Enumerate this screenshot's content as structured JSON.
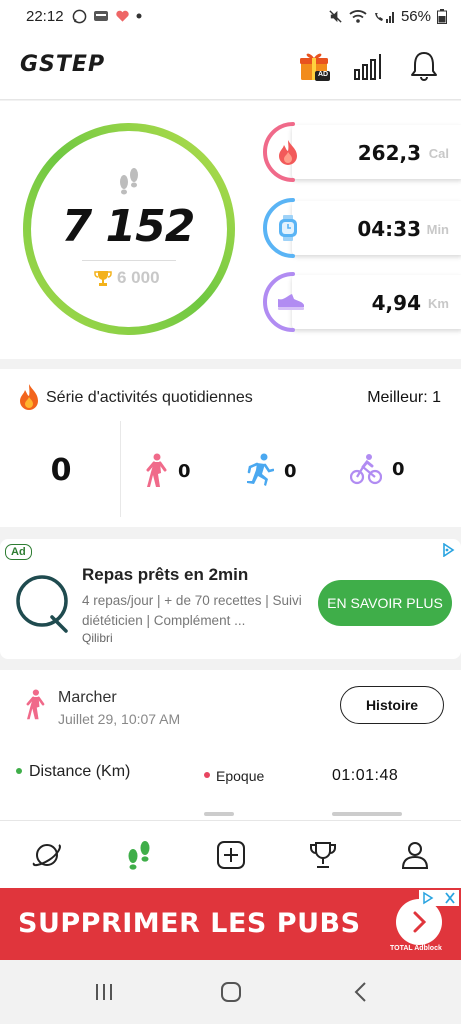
{
  "status_bar": {
    "time": "22:12",
    "battery": "56%",
    "icons": [
      "whatsapp-icon",
      "cashback-icon",
      "heart-icon",
      "dot-icon",
      "mute-icon",
      "wifi-icon",
      "call-signal-icon",
      "battery-icon"
    ]
  },
  "header": {
    "logo": "GSTEP",
    "icons": [
      "gift-icon",
      "bar-chart-icon",
      "bell-icon"
    ],
    "gift_badge": "AD"
  },
  "steps": {
    "value": "7 152",
    "goal": "6 000",
    "progress_fraction": 1.0
  },
  "metrics": [
    {
      "icon": "flame-icon",
      "value": "262,3",
      "unit": "Cal",
      "color": "#f06a8a"
    },
    {
      "icon": "watch-icon",
      "value": "04:33",
      "unit": "Min",
      "color": "#5ab4f5"
    },
    {
      "icon": "shoe-icon",
      "value": "4,94",
      "unit": "Km",
      "color": "#b18cf2"
    }
  ],
  "streak": {
    "title": "Série d'activités quotidiennes",
    "best": "Meilleur: 1",
    "count": "0",
    "activities": [
      {
        "icon": "walk-icon",
        "value": "0",
        "color": "#f06a8a"
      },
      {
        "icon": "run-icon",
        "value": "0",
        "color": "#4aa8f0"
      },
      {
        "icon": "bike-icon",
        "value": "0",
        "color": "#b18cf2"
      }
    ]
  },
  "ad": {
    "badge": "Ad",
    "title": "Repas prêts en 2min",
    "description": "4 repas/jour | + de 70 recettes | Suivi diététicien | Complément ...",
    "brand": "Qilibri",
    "cta": "EN SAVOIR PLUS"
  },
  "history": {
    "activity": "Marcher",
    "date": "Juillet 29, 10:07 AM",
    "button": "Histoire",
    "distance_label": "Distance (Km)",
    "epoque_label": "Epoque",
    "duration": "01:01:48"
  },
  "bottom_nav": {
    "items": [
      "planet-icon",
      "footsteps-icon",
      "plus-square-icon",
      "trophy-icon",
      "user-icon"
    ],
    "active": "footsteps-icon",
    "active_color": "#3fae49"
  },
  "banner": {
    "text": "SUPPRIMER LES PUBS",
    "sub": "TOTAL Adblock"
  },
  "system_nav": [
    "recents-icon",
    "home-icon",
    "back-icon"
  ]
}
